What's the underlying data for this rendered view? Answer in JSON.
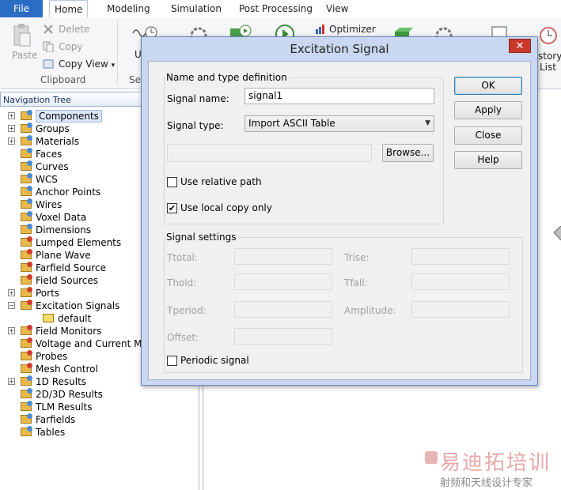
{
  "ribbon": {
    "tabs": [
      "File",
      "Home",
      "Modeling",
      "Simulation",
      "Post Processing",
      "View"
    ],
    "active_tab": "Home",
    "clipboard": {
      "paste": "Paste",
      "delete": "Delete",
      "copy": "Copy",
      "copy_view": "Copy View",
      "copy_view_arrow": "▾",
      "group_label": "Clipboard"
    },
    "fragments": {
      "u_label": "U",
      "se_label": "Se",
      "optimizer": "Optimizer",
      "history_line1": "story",
      "history_line2": "List"
    }
  },
  "nav": {
    "title": "Navigation Tree",
    "items": [
      {
        "label": "Components",
        "expander": "+"
      },
      {
        "label": "Groups",
        "expander": "+"
      },
      {
        "label": "Materials",
        "expander": "+"
      },
      {
        "label": "Faces",
        "expander": ""
      },
      {
        "label": "Curves",
        "expander": ""
      },
      {
        "label": "WCS",
        "expander": ""
      },
      {
        "label": "Anchor Points",
        "expander": ""
      },
      {
        "label": "Wires",
        "expander": ""
      },
      {
        "label": "Voxel Data",
        "expander": ""
      },
      {
        "label": "Dimensions",
        "expander": ""
      },
      {
        "label": "Lumped Elements",
        "expander": ""
      },
      {
        "label": "Plane Wave",
        "expander": ""
      },
      {
        "label": "Farfield Source",
        "expander": ""
      },
      {
        "label": "Field Sources",
        "expander": ""
      },
      {
        "label": "Ports",
        "expander": "+"
      },
      {
        "label": "Excitation Signals",
        "expander": "−"
      },
      {
        "label": "default",
        "expander": ""
      },
      {
        "label": "Field Monitors",
        "expander": "+"
      },
      {
        "label": "Voltage and Current Mo",
        "expander": ""
      },
      {
        "label": "Probes",
        "expander": ""
      },
      {
        "label": "Mesh Control",
        "expander": ""
      },
      {
        "label": "1D Results",
        "expander": "+"
      },
      {
        "label": "2D/3D Results",
        "expander": ""
      },
      {
        "label": "TLM Results",
        "expander": ""
      },
      {
        "label": "Farfields",
        "expander": ""
      },
      {
        "label": "Tables",
        "expander": ""
      }
    ]
  },
  "dialog": {
    "title": "Excitation Signal",
    "close_symbol": "✕",
    "name_group": {
      "title": "Name and type definition",
      "signal_name_label": "Signal name:",
      "signal_name_value": "signal1",
      "signal_type_label": "Signal type:",
      "signal_type_value": "Import ASCII Table",
      "file_path_value": "",
      "browse": "Browse...",
      "use_relative_path": "Use relative path",
      "use_relative_path_checked": false,
      "use_local_copy": "Use local copy only",
      "use_local_copy_checked": true
    },
    "settings_group": {
      "title": "Signal settings",
      "ttotal": "Ttotal:",
      "trise": "Trise:",
      "thold": "Thold:",
      "tfall": "Tfall:",
      "tperiod": "Tperiod:",
      "amplitude": "Amplitude:",
      "offset": "Offset:",
      "periodic": "Periodic signal",
      "periodic_checked": false
    },
    "buttons": {
      "ok": "OK",
      "apply": "Apply",
      "close": "Close",
      "help": "Help"
    }
  },
  "watermark": {
    "line1": "易迪拓培训",
    "line2": "射频和天线设计专家"
  }
}
